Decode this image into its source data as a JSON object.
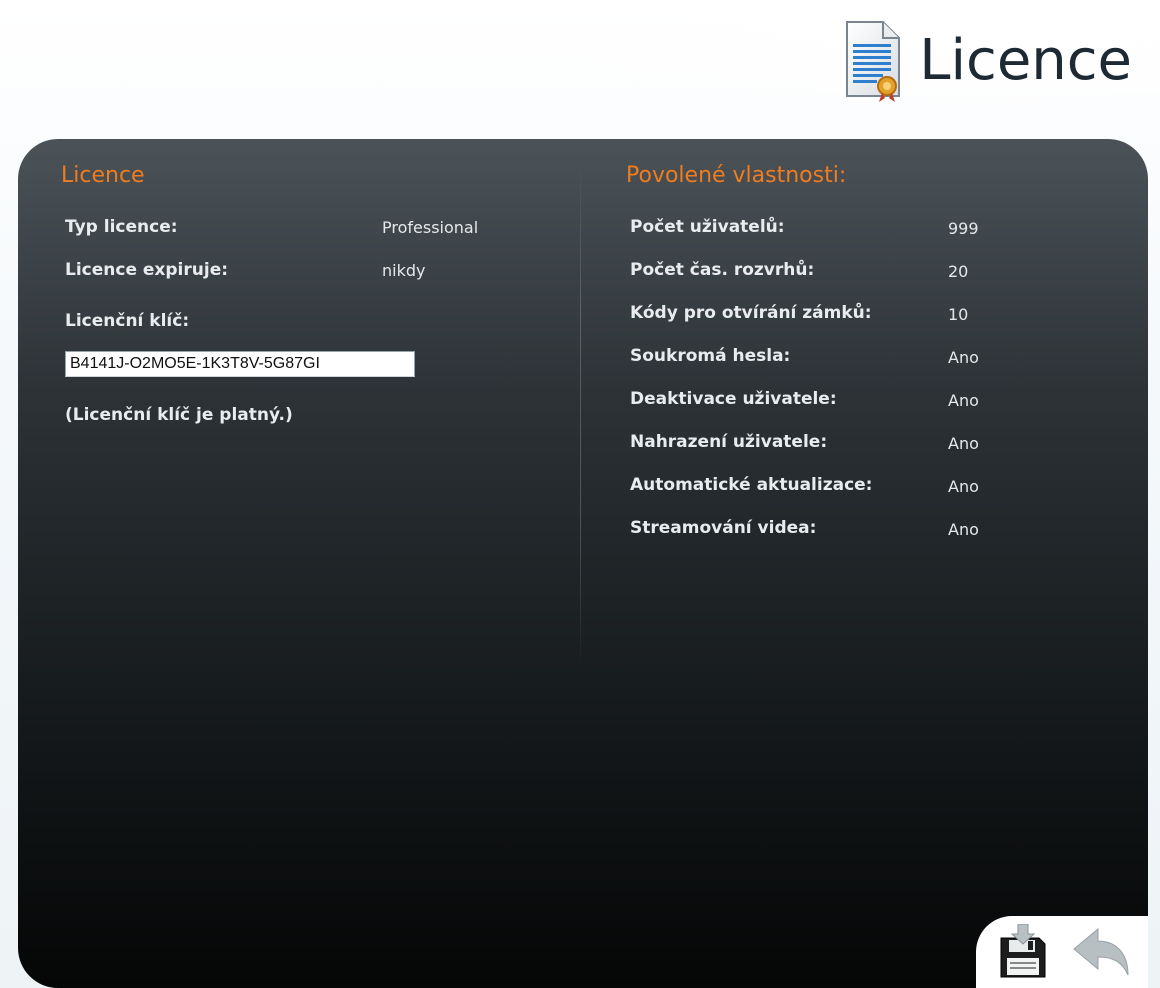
{
  "header": {
    "title": "Licence",
    "icon": "license-certificate-icon"
  },
  "license_section": {
    "title": "Licence",
    "type_label": "Typ licence:",
    "type_value": "Professional",
    "expires_label": "Licence expiruje:",
    "expires_value": "nikdy",
    "key_label": "Licenční klíč:",
    "key_value": "B4141J-O2MO5E-1K3T8V-5G87GI",
    "key_status": "(Licenční klíč je platný.)"
  },
  "features_section": {
    "title": "Povolené vlastnosti:",
    "items": [
      {
        "label": "Počet uživatelů:",
        "value": "999"
      },
      {
        "label": "Počet čas. rozvrhů:",
        "value": "20"
      },
      {
        "label": "Kódy pro otvírání zámků:",
        "value": "10"
      },
      {
        "label": "Soukromá hesla:",
        "value": "Ano"
      },
      {
        "label": "Deaktivace uživatele:",
        "value": "Ano"
      },
      {
        "label": "Nahrazení uživatele:",
        "value": "Ano"
      },
      {
        "label": "Automatické aktualizace:",
        "value": "Ano"
      },
      {
        "label": "Streamování videa:",
        "value": "Ano"
      }
    ]
  },
  "toolbar": {
    "save_icon": "save-disk-icon",
    "back_icon": "back-arrow-icon"
  },
  "colors": {
    "accent": "#f07c1e",
    "panel_top": "#4b5358",
    "panel_bottom": "#050606"
  }
}
